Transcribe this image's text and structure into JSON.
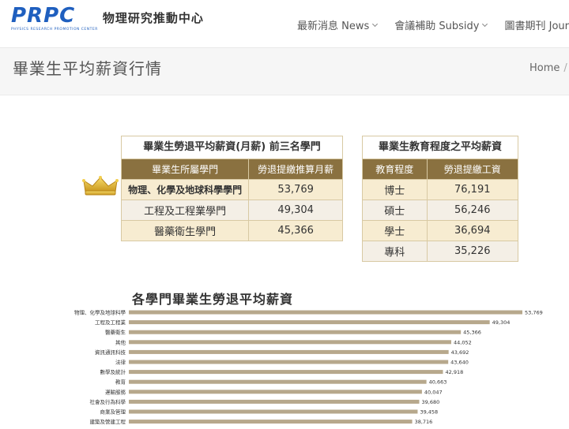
{
  "header": {
    "logo_letters": "PRPC",
    "logo_subtitle": "PHYSICS RESEARCH PROMOTION CENTER",
    "logo_name": "物理研究推動中心",
    "nav": [
      {
        "label": "最新消息 News"
      },
      {
        "label": "會議補助 Subsidy"
      },
      {
        "label": "圖書期刊 Journ"
      }
    ]
  },
  "page": {
    "title": "畢業生平均薪資行情",
    "breadcrumb": [
      "Home",
      "/"
    ]
  },
  "top3_table": {
    "title": "畢業生勞退平均薪資(月薪) 前三名學門",
    "headers": [
      "畢業生所屬學門",
      "勞退提繳推算月薪"
    ],
    "rows": [
      {
        "field": "物理、化學及地球科學學門",
        "salary": "53,769"
      },
      {
        "field": "工程及工程業學門",
        "salary": "49,304"
      },
      {
        "field": "醫藥衛生學門",
        "salary": "45,366"
      }
    ]
  },
  "edu_table": {
    "title": "畢業生教育程度之平均薪資",
    "headers": [
      "教育程度",
      "勞退提繳工資"
    ],
    "rows": [
      {
        "level": "博士",
        "salary": "76,191"
      },
      {
        "level": "碩士",
        "salary": "56,246"
      },
      {
        "level": "學士",
        "salary": "36,694"
      },
      {
        "level": "專科",
        "salary": "35,226"
      }
    ]
  },
  "colors": {
    "bar": "#b7a88c",
    "table_header": "#8a7140",
    "table_cream": "#f7ecd1",
    "logo_blue": "#1f5fbf",
    "crown": "#e9c23a"
  },
  "chart_data": {
    "type": "bar",
    "orientation": "horizontal",
    "title": "各學門畢業生勞退平均薪資",
    "categories": [
      "物理、化學及地球科學",
      "工程及工程業",
      "醫藥衛生",
      "其他",
      "資訊通訊科技",
      "法律",
      "數學及統計",
      "教育",
      "運輸服務",
      "社會及行為科學",
      "商業及管理",
      "建築及營建工程"
    ],
    "values": [
      53769,
      49304,
      45366,
      44052,
      43692,
      43640,
      42918,
      40663,
      40047,
      39680,
      39458,
      38716
    ],
    "value_labels": [
      "53,769",
      "49,304",
      "45,366",
      "44,052",
      "43,692",
      "43,640",
      "42,918",
      "40,663",
      "40,047",
      "39,680",
      "39,458",
      "38,716"
    ],
    "xlim": [
      0,
      53769
    ],
    "grid": false
  }
}
